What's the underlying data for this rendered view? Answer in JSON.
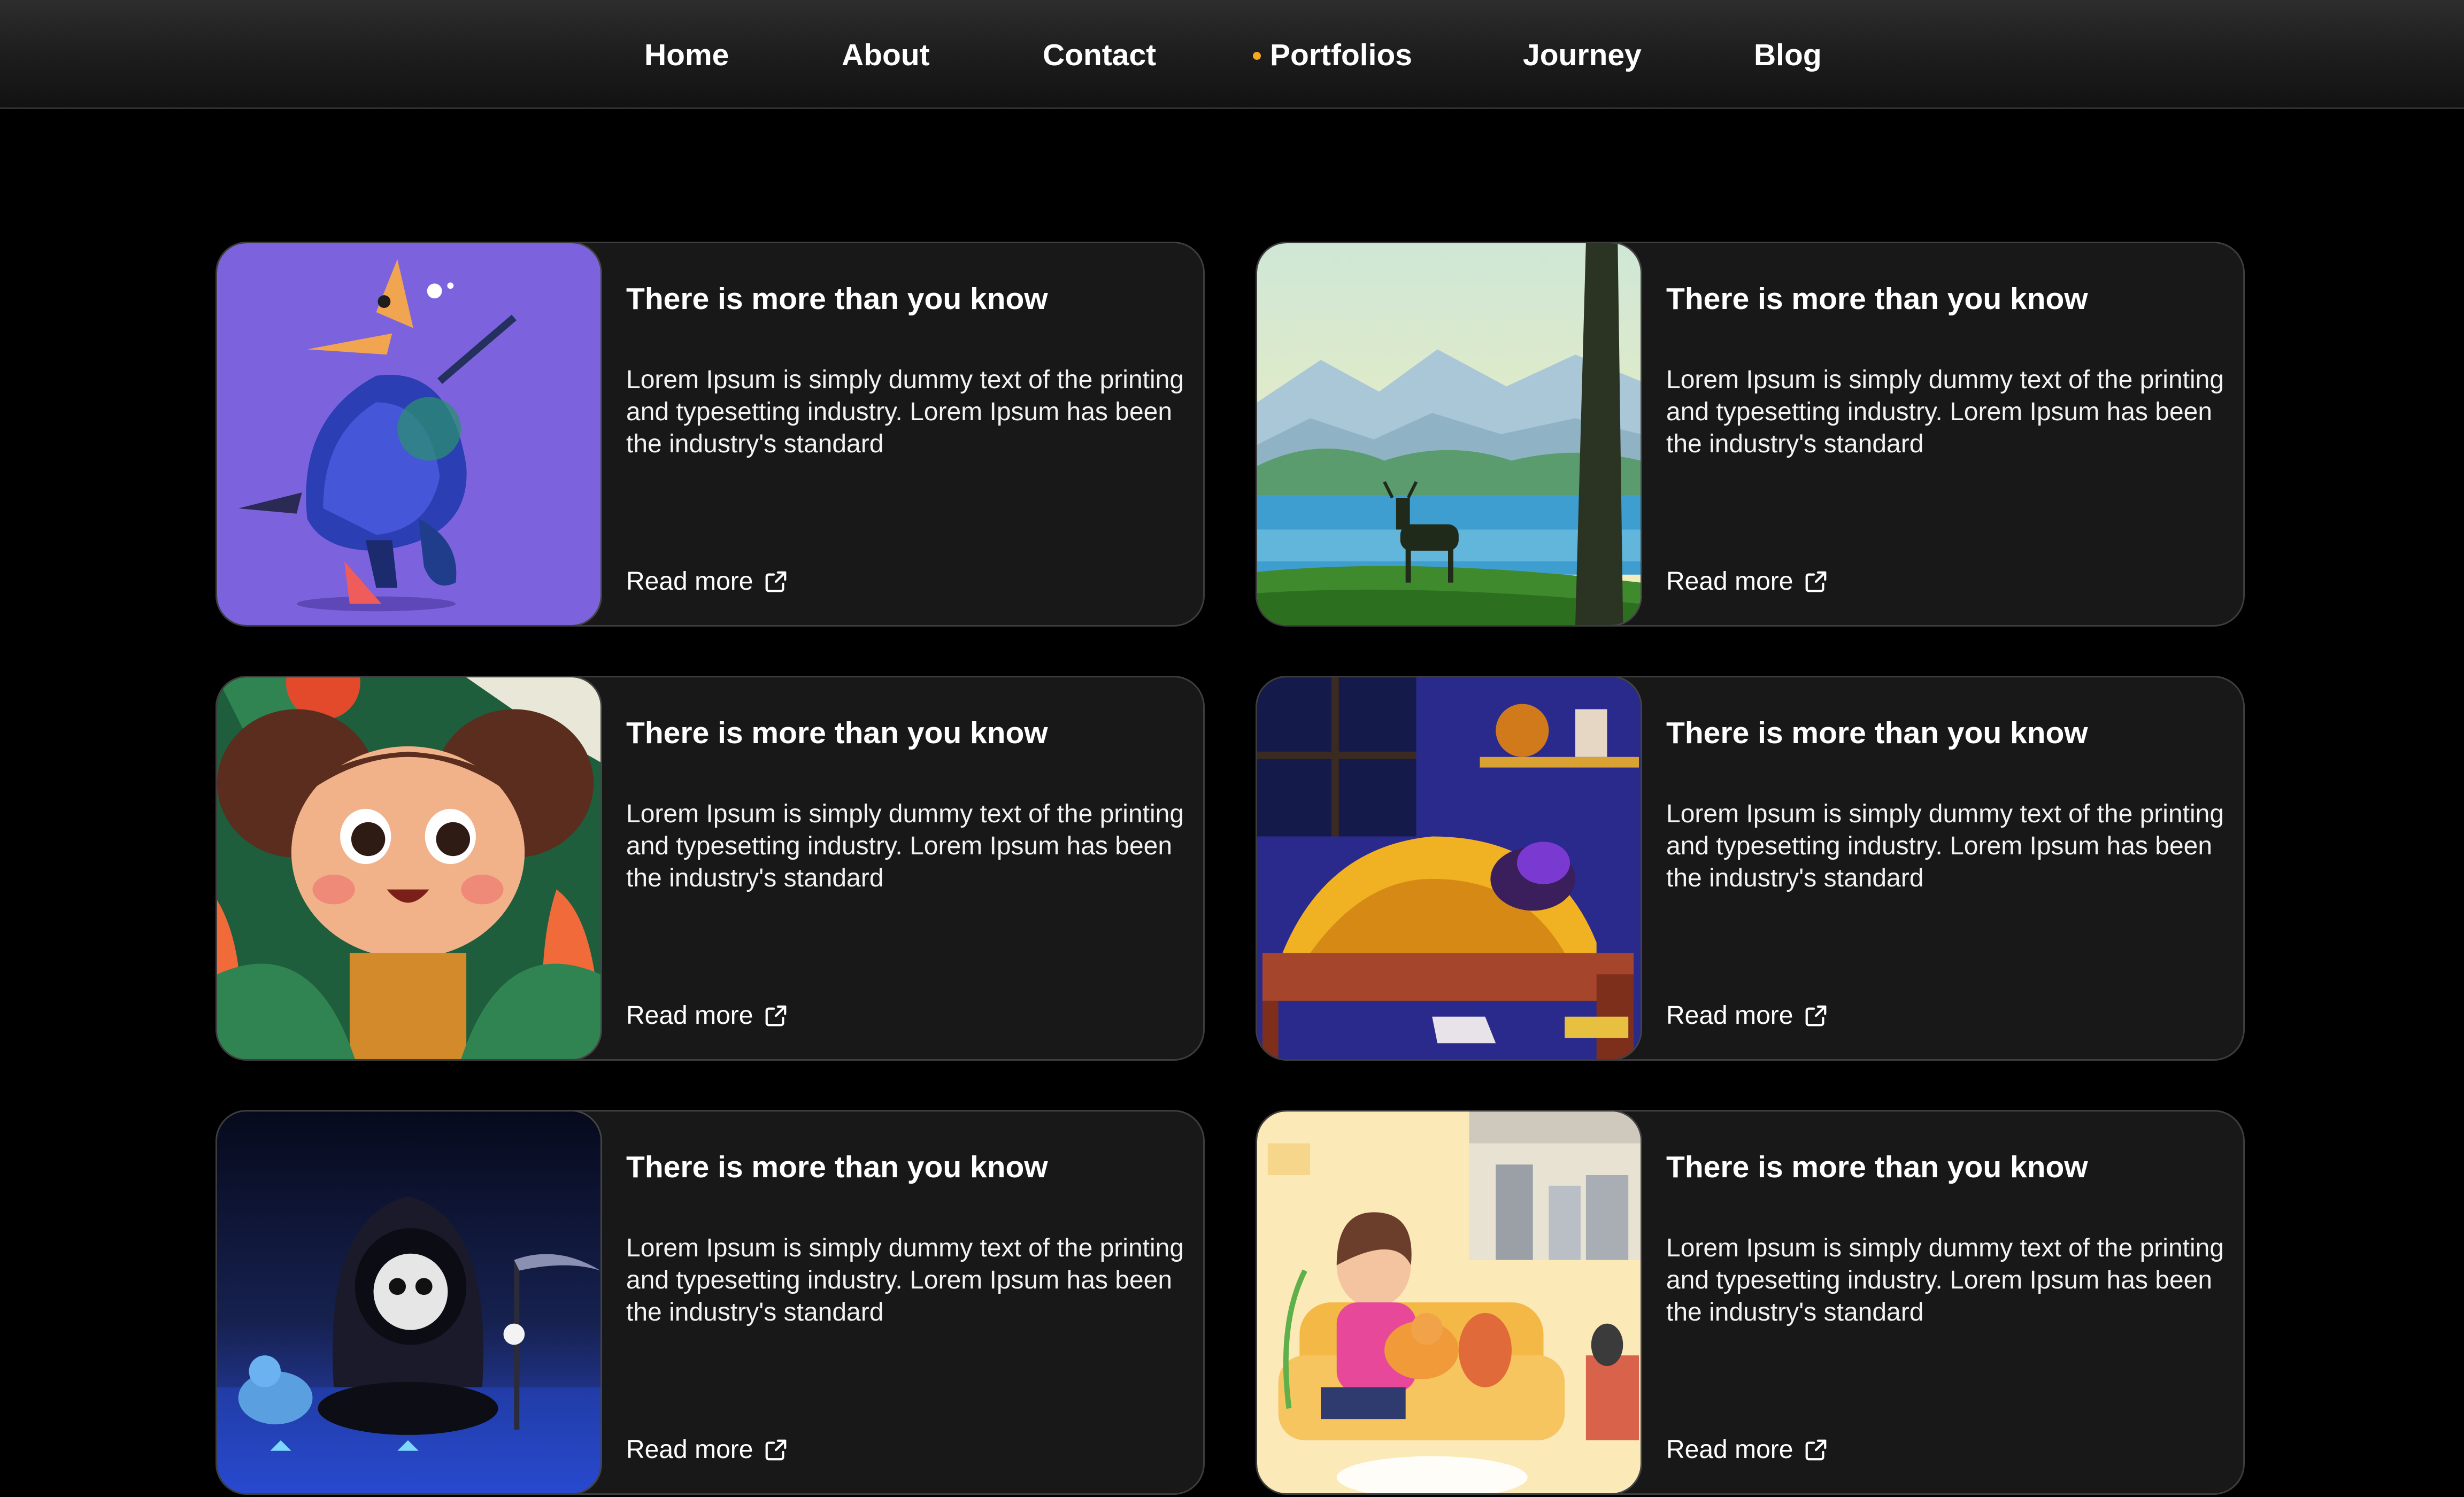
{
  "nav": {
    "items": [
      {
        "label": "Home",
        "active": false
      },
      {
        "label": "About",
        "active": false
      },
      {
        "label": "Contact",
        "active": false
      },
      {
        "label": "Portfolios",
        "active": true
      },
      {
        "label": "Journey",
        "active": false
      },
      {
        "label": "Blog",
        "active": false
      }
    ],
    "active_indicator_color": "#f5a623"
  },
  "cards": [
    {
      "title": "There is more than you know",
      "body": "Lorem Ipsum is simply dummy text of the printing and typesetting industry. Lorem Ipsum has been the industry's standard",
      "link": "Read more",
      "image": "wizard-bird-illustration"
    },
    {
      "title": "There is more than you know",
      "body": "Lorem Ipsum is simply dummy text of the printing and typesetting industry. Lorem Ipsum has been the industry's standard",
      "link": "Read more",
      "image": "deer-lake-landscape-illustration"
    },
    {
      "title": "There is more than you know",
      "body": "Lorem Ipsum is simply dummy text of the printing and typesetting industry. Lorem Ipsum has been the industry's standard",
      "link": "Read more",
      "image": "girl-in-jungle-illustration"
    },
    {
      "title": "There is more than you know",
      "body": "Lorem Ipsum is simply dummy text of the printing and typesetting industry. Lorem Ipsum has been the industry's standard",
      "link": "Read more",
      "image": "sleeping-in-bed-illustration"
    },
    {
      "title": "There is more than you know",
      "body": "Lorem Ipsum is simply dummy text of the printing and typesetting industry. Lorem Ipsum has been the industry's standard",
      "link": "Read more",
      "image": "grim-reaper-illustration"
    },
    {
      "title": "There is more than you know",
      "body": "Lorem Ipsum is simply dummy text of the printing and typesetting industry. Lorem Ipsum has been the industry's standard",
      "link": "Read more",
      "image": "woman-with-cat-illustration"
    }
  ],
  "icons": {
    "read_more": "external-link-icon"
  }
}
